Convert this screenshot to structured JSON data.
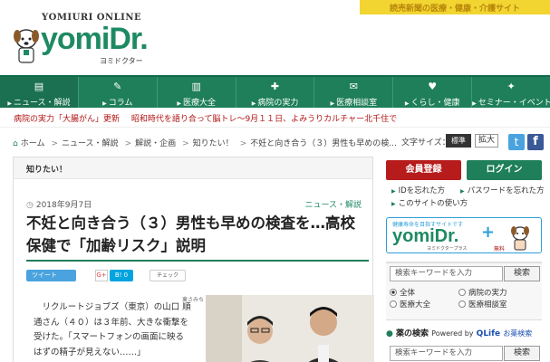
{
  "header": {
    "tagline": "読売新聞の医療・健康・介護サイト",
    "brand_sub": "YOMIURI ONLINE",
    "logo": "yomiDr.",
    "logo_kana": "ヨミドクター"
  },
  "nav": {
    "items": [
      {
        "label": "ニュース・解説",
        "icon": "newspaper-icon",
        "glyph": "▤"
      },
      {
        "label": "コラム",
        "icon": "pen-icon",
        "glyph": "✎"
      },
      {
        "label": "医療大全",
        "icon": "book-icon",
        "glyph": "▥"
      },
      {
        "label": "病院の実力",
        "icon": "hospital-icon",
        "glyph": "✚"
      },
      {
        "label": "医療相談室",
        "icon": "chat-icon",
        "glyph": "✉"
      },
      {
        "label": "くらし・健康",
        "icon": "heart-icon",
        "glyph": "♥"
      },
      {
        "label": "セミナー・イベント",
        "icon": "megaphone-icon",
        "glyph": "✦"
      }
    ]
  },
  "ticker": {
    "item1": "病院の実力「大腸がん」更新",
    "item2": "昭和時代を語り合って脳トレ～9月１１日、よみうりカルチャー北千住で"
  },
  "breadcrumb": {
    "home": "ホーム",
    "items": [
      "ニュース・解説",
      "解説・企画",
      "知りたい！",
      "不妊と向き合う（３）男性も早めの検..."
    ]
  },
  "font_size": {
    "label": "文字サイズ：",
    "standard": "標準",
    "large": "拡大"
  },
  "social": {
    "twitter": "t",
    "facebook": "f"
  },
  "article": {
    "category": "知りたい！",
    "date": "2018年9月7日",
    "section": "ニュース・解説",
    "title": "不妊と向き合う（３）男性も早めの検査を…高校保健で「加齢リスク」説明",
    "share_tweet": "ツイート",
    "share_g": "G+",
    "share_b": "B! 0",
    "share_check": "チェック",
    "author": "東さみち",
    "body": "　リクルートジョブズ（東京）の山口 順 通さん（４０）は３年前、大きな衝撃を受けた。「スマートフォンの画面に映るはずの精子が見えない……」"
  },
  "sidebar": {
    "register": "会員登録",
    "login": "ログイン",
    "links": [
      "IDを忘れた方",
      "パスワードを忘れた方",
      "このサイトの使い方"
    ],
    "plus": {
      "caption": "健康寿命を目指すサイトです",
      "logo": "yomiDr.",
      "plus": "+",
      "kana": "ヨミドクタープラス",
      "free": "無料"
    },
    "search": {
      "placeholder": "検索キーワードを入力",
      "button": "検索",
      "options": [
        "全体",
        "病院の実力",
        "医療大全",
        "医療相談室"
      ],
      "selected": "全体"
    },
    "drug": {
      "title": "薬の検索",
      "powered": "Powered by",
      "brand": "QLife",
      "suffix": "お薬検索",
      "placeholder": "検索キーワードを入力",
      "button": "検索"
    }
  },
  "colors": {
    "brand_green": "#1e7f5a",
    "tag_yellow": "#f2d531",
    "register_red": "#b71c1c",
    "twitter_blue": "#4aa3df",
    "facebook_blue": "#3b5998"
  }
}
